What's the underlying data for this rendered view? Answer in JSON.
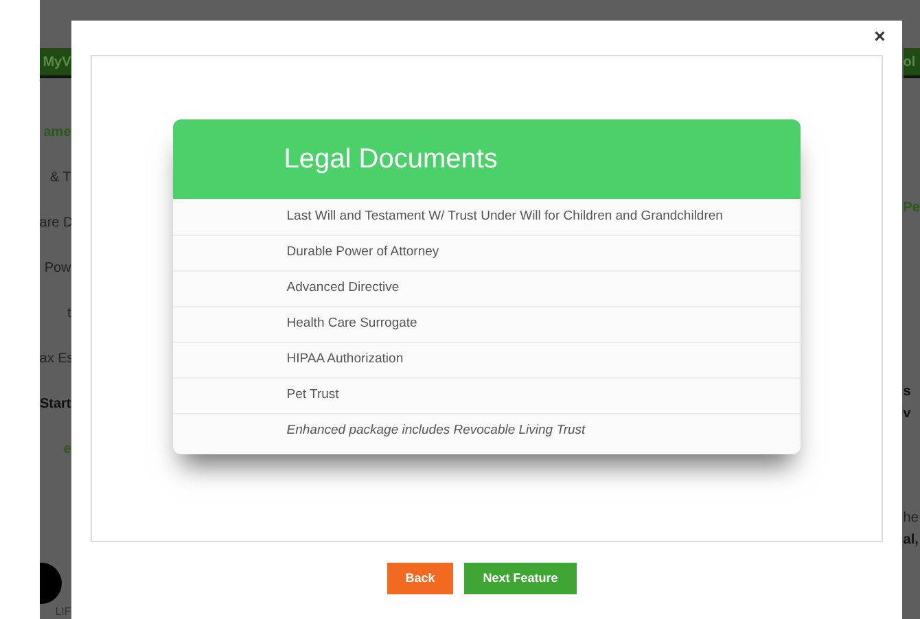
{
  "background": {
    "left": [
      {
        "text": "MyV",
        "kind": "header"
      },
      {
        "text": "ame",
        "kind": "accent"
      },
      {
        "text": "& T",
        "kind": "plain"
      },
      {
        "text": "are D",
        "kind": "plain"
      },
      {
        "text": "Pow",
        "kind": "plain"
      },
      {
        "text": "t",
        "kind": "plain"
      },
      {
        "text": "ax Es",
        "kind": "plain"
      },
      {
        "text": "Start",
        "kind": "strong"
      },
      {
        "text": "e",
        "kind": "accent"
      }
    ],
    "left_footer": "LIF",
    "right": [
      {
        "text": "ol",
        "kind": "header"
      },
      {
        "text": "Pe",
        "kind": "accent"
      },
      {
        "text": "s",
        "kind": "strong"
      },
      {
        "text": "v",
        "kind": "strong"
      },
      {
        "text": "he",
        "kind": "plain"
      },
      {
        "text": "al,",
        "kind": "strong"
      }
    ]
  },
  "modal": {
    "close": "×",
    "card": {
      "title": "Legal Documents",
      "items": [
        {
          "text": "Last Will and Testament W/ Trust Under Will for Children and Grandchildren",
          "kind": "item"
        },
        {
          "text": "Durable Power of Attorney",
          "kind": "item"
        },
        {
          "text": "Advanced Directive",
          "kind": "item"
        },
        {
          "text": "Health Care Surrogate",
          "kind": "item"
        },
        {
          "text": "HIPAA Authorization",
          "kind": "item"
        },
        {
          "text": "Pet Trust",
          "kind": "item"
        },
        {
          "text": "Enhanced package includes Revocable Living Trust",
          "kind": "note"
        }
      ]
    },
    "buttons": [
      {
        "label": "Back",
        "kind": "secondary"
      },
      {
        "label": "Next Feature",
        "kind": "primary"
      }
    ]
  }
}
